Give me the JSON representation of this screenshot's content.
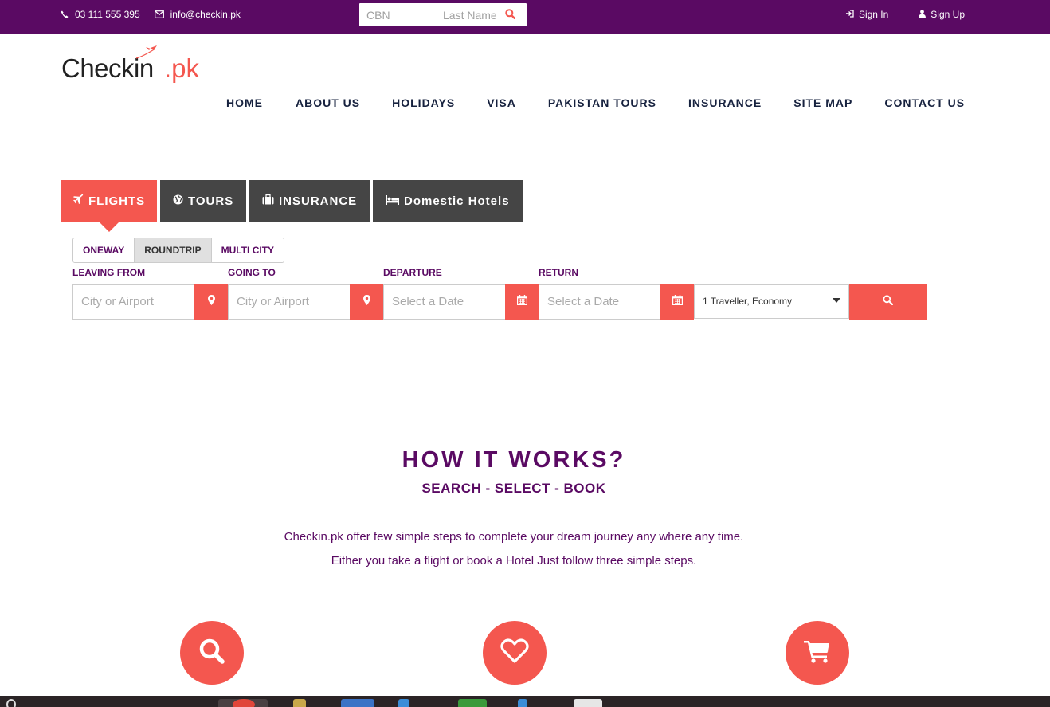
{
  "topbar": {
    "phone": "03 111 555 395",
    "email": "info@checkin.pk",
    "search": {
      "cbn_placeholder": "CBN",
      "lastname_placeholder": "Last Name"
    },
    "sign_in": "Sign In",
    "sign_up": "Sign Up"
  },
  "logo": {
    "main": "Checkin",
    "suffix": ".pk"
  },
  "nav": [
    "HOME",
    "ABOUT US",
    "HOLIDAYS",
    "VISA",
    "PAKISTAN TOURS",
    "INSURANCE",
    "SITE MAP",
    "CONTACT US"
  ],
  "tabs": [
    "FLIGHTS",
    "TOURS",
    "INSURANCE",
    "Domestic Hotels"
  ],
  "trip_types": [
    "ONEWAY",
    "ROUNDTRIP",
    "MULTI CITY"
  ],
  "trip_selected": "ROUNDTRIP",
  "form": {
    "leaving_label": "LEAVING FROM",
    "leaving_placeholder": "City or Airport",
    "going_label": "GOING TO",
    "going_placeholder": "City or Airport",
    "departure_label": "DEPARTURE",
    "departure_placeholder": "Select a Date",
    "return_label": "RETURN",
    "return_placeholder": "Select a Date",
    "travellers": "1 Traveller, Economy"
  },
  "how": {
    "title": "HOW IT WORKS?",
    "subtitle": "SEARCH - SELECT - BOOK",
    "para1": "Checkin.pk offer few simple steps to complete your dream journey any where any time.",
    "para2": "Either you take a flight or book a Hotel Just follow three simple steps."
  },
  "steps_icons": [
    "search-icon",
    "heart-icon",
    "cart-icon"
  ],
  "colors": {
    "brand_purple": "#5a0a63",
    "accent_red": "#f4574f",
    "tab_dark": "#454545"
  }
}
